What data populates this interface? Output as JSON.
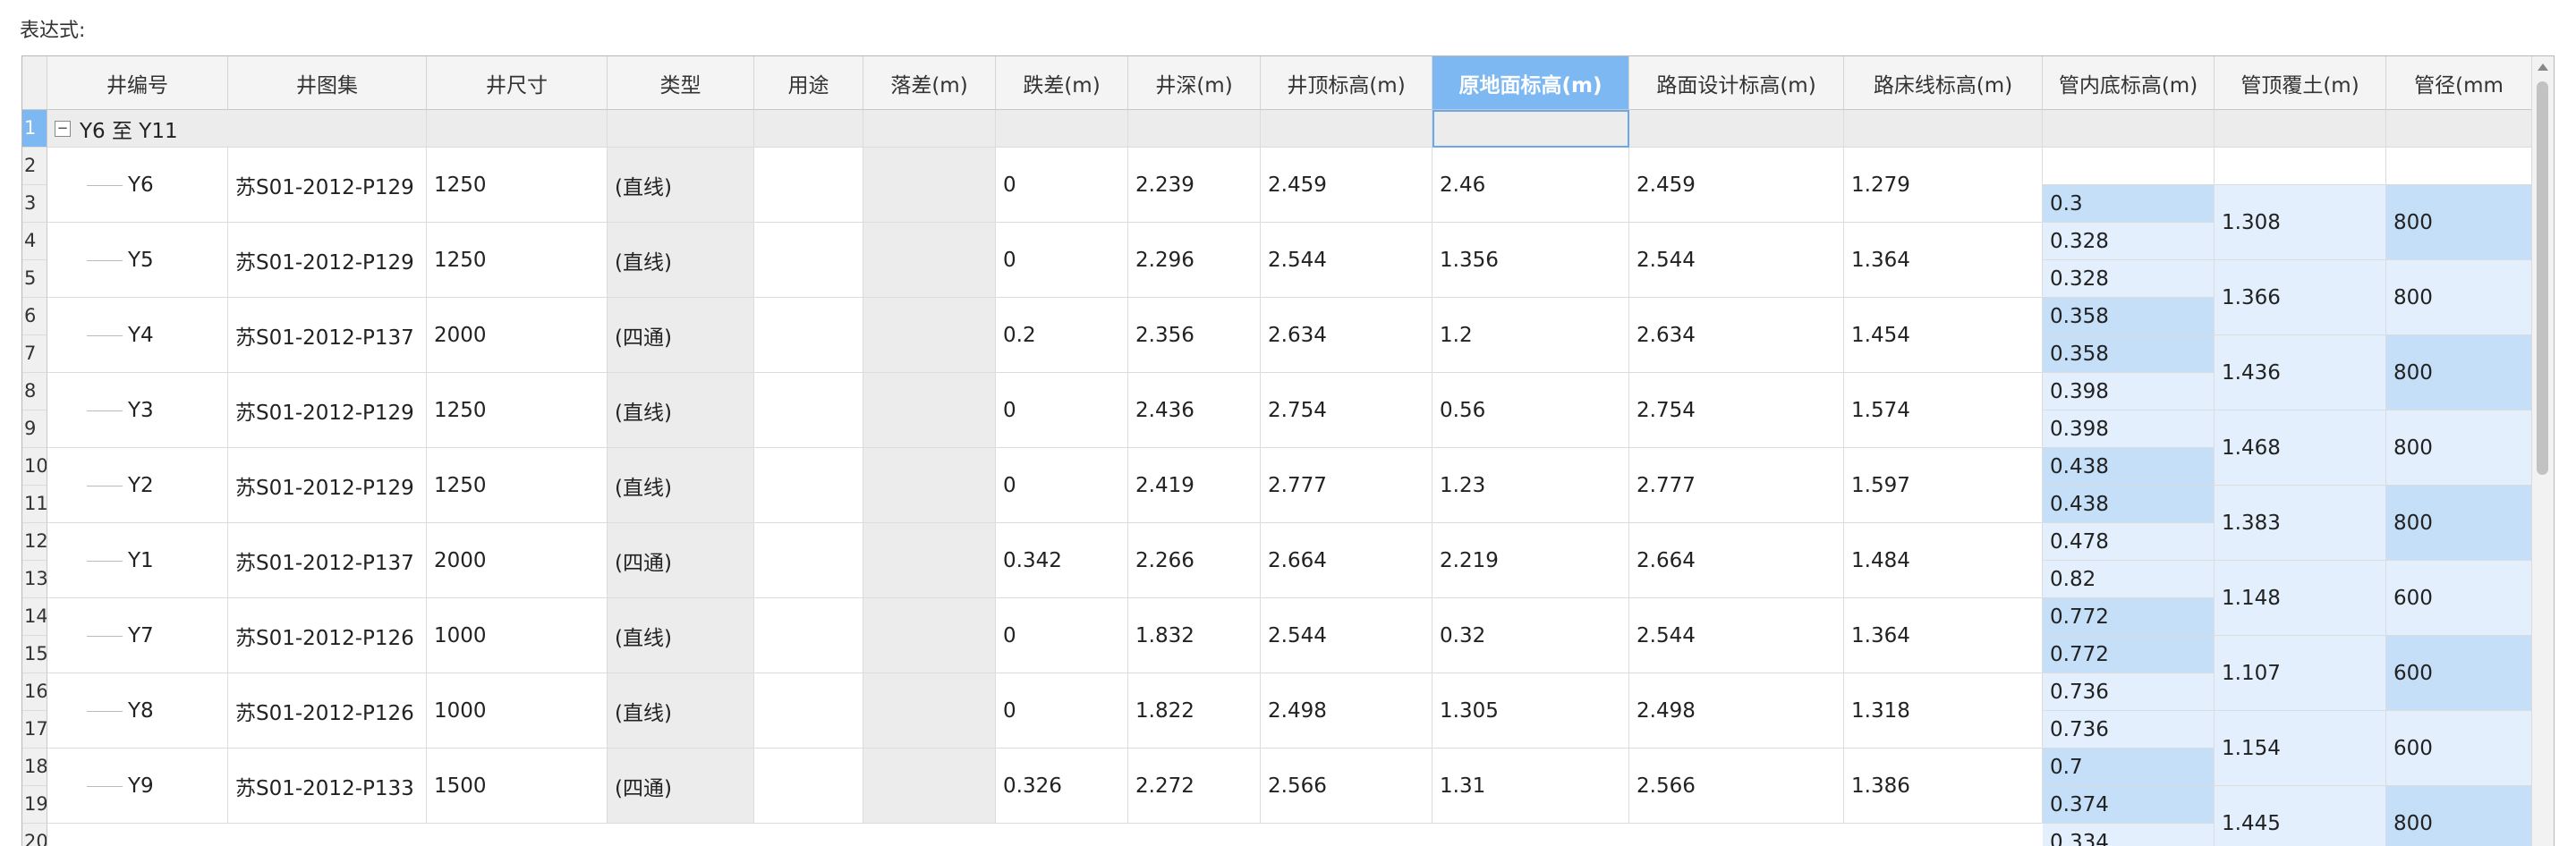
{
  "expression_label": "表达式:",
  "columns": [
    "井编号",
    "井图集",
    "井尺寸",
    "类型",
    "用途",
    "落差(m)",
    "跌差(m)",
    "井深(m)",
    "井顶标高(m)",
    "原地面标高(m)",
    "路面设计标高(m)",
    "路床线标高(m)",
    "管内底标高(m)",
    "管顶覆土(m)",
    "管径(mm"
  ],
  "selected_column": "原地面标高(m)",
  "group_row": {
    "row_number": "1",
    "toggle": "−",
    "label": "Y6 至 Y11"
  },
  "row_numbers": [
    "2",
    "3",
    "4",
    "5",
    "6",
    "7",
    "8",
    "9",
    "10",
    "11",
    "12",
    "13",
    "14",
    "15",
    "16",
    "17",
    "18",
    "19",
    "20"
  ],
  "wells": [
    {
      "id": "Y6",
      "atlas": "苏S01-2012-P129",
      "size": "1250",
      "type": "(直线)",
      "use": "",
      "drop": "",
      "jump": "0",
      "depth": "2.239",
      "top": "2.459",
      "ground": "2.46",
      "road": "2.459",
      "subgrade": "1.279"
    },
    {
      "id": "Y5",
      "atlas": "苏S01-2012-P129",
      "size": "1250",
      "type": "(直线)",
      "use": "",
      "drop": "",
      "jump": "0",
      "depth": "2.296",
      "top": "2.544",
      "ground": "1.356",
      "road": "2.544",
      "subgrade": "1.364"
    },
    {
      "id": "Y4",
      "atlas": "苏S01-2012-P137",
      "size": "2000",
      "type": "(四通)",
      "use": "",
      "drop": "",
      "jump": "0.2",
      "depth": "2.356",
      "top": "2.634",
      "ground": "1.2",
      "road": "2.634",
      "subgrade": "1.454"
    },
    {
      "id": "Y3",
      "atlas": "苏S01-2012-P129",
      "size": "1250",
      "type": "(直线)",
      "use": "",
      "drop": "",
      "jump": "0",
      "depth": "2.436",
      "top": "2.754",
      "ground": "0.56",
      "road": "2.754",
      "subgrade": "1.574"
    },
    {
      "id": "Y2",
      "atlas": "苏S01-2012-P129",
      "size": "1250",
      "type": "(直线)",
      "use": "",
      "drop": "",
      "jump": "0",
      "depth": "2.419",
      "top": "2.777",
      "ground": "1.23",
      "road": "2.777",
      "subgrade": "1.597"
    },
    {
      "id": "Y1",
      "atlas": "苏S01-2012-P137",
      "size": "2000",
      "type": "(四通)",
      "use": "",
      "drop": "",
      "jump": "0.342",
      "depth": "2.266",
      "top": "2.664",
      "ground": "2.219",
      "road": "2.664",
      "subgrade": "1.484"
    },
    {
      "id": "Y7",
      "atlas": "苏S01-2012-P126",
      "size": "1000",
      "type": "(直线)",
      "use": "",
      "drop": "",
      "jump": "0",
      "depth": "1.832",
      "top": "2.544",
      "ground": "0.32",
      "road": "2.544",
      "subgrade": "1.364"
    },
    {
      "id": "Y8",
      "atlas": "苏S01-2012-P126",
      "size": "1000",
      "type": "(直线)",
      "use": "",
      "drop": "",
      "jump": "0",
      "depth": "1.822",
      "top": "2.498",
      "ground": "1.305",
      "road": "2.498",
      "subgrade": "1.318"
    },
    {
      "id": "Y9",
      "atlas": "苏S01-2012-P133",
      "size": "1500",
      "type": "(四通)",
      "use": "",
      "drop": "",
      "jump": "0.326",
      "depth": "2.272",
      "top": "2.566",
      "ground": "1.31",
      "road": "2.566",
      "subgrade": "1.386"
    }
  ],
  "pipes": [
    {
      "inverts": [
        "0.3",
        "0.328"
      ],
      "cover": "1.308",
      "diameter": "800"
    },
    {
      "inverts": [
        "0.328",
        "0.358"
      ],
      "cover": "1.366",
      "diameter": "800"
    },
    {
      "inverts": [
        "0.358",
        "0.398"
      ],
      "cover": "1.436",
      "diameter": "800"
    },
    {
      "inverts": [
        "0.398",
        "0.438"
      ],
      "cover": "1.468",
      "diameter": "800"
    },
    {
      "inverts": [
        "0.438",
        "0.478"
      ],
      "cover": "1.383",
      "diameter": "800"
    },
    {
      "inverts": [
        "0.82",
        "0.772"
      ],
      "cover": "1.148",
      "diameter": "600"
    },
    {
      "inverts": [
        "0.772",
        "0.736"
      ],
      "cover": "1.107",
      "diameter": "600"
    },
    {
      "inverts": [
        "0.736",
        "0.7"
      ],
      "cover": "1.154",
      "diameter": "600"
    },
    {
      "inverts": [
        "0.374",
        "0.334"
      ],
      "cover": "1.445",
      "diameter": "800"
    }
  ],
  "colors": {
    "selection": "#7eb8f2",
    "pipe_light": "#e3effc",
    "pipe_dark": "#c5dff9",
    "readonly": "#ececec"
  }
}
